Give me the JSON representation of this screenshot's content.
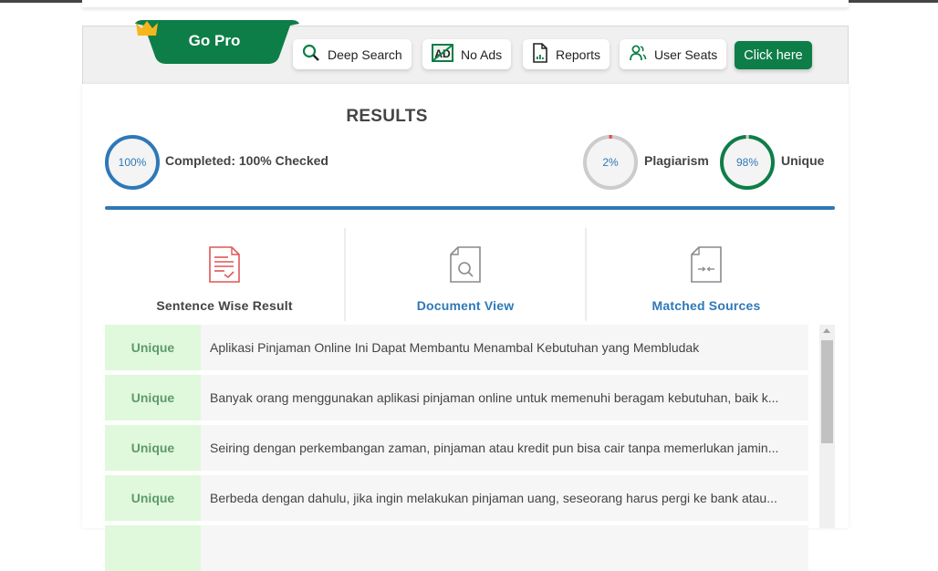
{
  "promo": {
    "go_pro_label": "Go Pro",
    "features": [
      {
        "label": "Deep Search",
        "icon": "search-icon"
      },
      {
        "label": "No Ads",
        "icon": "no-ads-icon"
      },
      {
        "label": "Reports",
        "icon": "report-icon"
      },
      {
        "label": "User Seats",
        "icon": "users-icon"
      }
    ],
    "cta_label": "Click here",
    "brand_color": "#0e7e48"
  },
  "results": {
    "title": "RESULTS",
    "completed": {
      "percent": 100,
      "percent_label": "100%",
      "label": "Completed: 100% Checked"
    },
    "plagiarism": {
      "percent": 2,
      "percent_label": "2%",
      "label": "Plagiarism",
      "color": "#e84c4c"
    },
    "unique": {
      "percent": 98,
      "percent_label": "98%",
      "label": "Unique",
      "color": "#0e7e48"
    },
    "progress_percent": 100
  },
  "tabs": [
    {
      "label": "Sentence Wise Result",
      "icon": "sentence-report-icon",
      "active": true
    },
    {
      "label": "Document View",
      "icon": "document-search-icon",
      "active": false
    },
    {
      "label": "Matched Sources",
      "icon": "document-compare-icon",
      "active": false
    }
  ],
  "sentences": [
    {
      "status": "Unique",
      "text": "Aplikasi Pinjaman Online Ini Dapat Membantu Menambal Kebutuhan yang Membludak"
    },
    {
      "status": "Unique",
      "text": "Banyak orang menggunakan aplikasi pinjaman online untuk memenuhi beragam kebutuhan, baik k..."
    },
    {
      "status": "Unique",
      "text": "Seiring dengan perkembangan zaman, pinjaman atau kredit pun bisa cair tanpa memerlukan jamin..."
    },
    {
      "status": "Unique",
      "text": "Berbeda dengan dahulu, jika ingin melakukan pinjaman uang, seseorang harus pergi ke bank atau..."
    }
  ]
}
